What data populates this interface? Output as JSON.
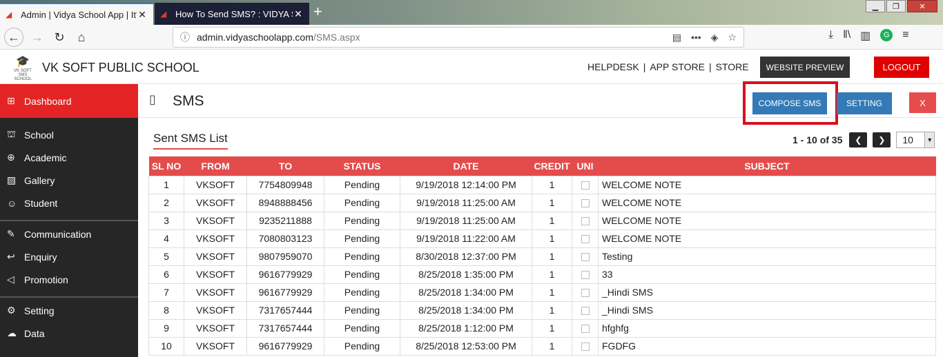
{
  "browser": {
    "tabs": [
      {
        "title": "Admin | Vidya School App | It's",
        "close": "✕"
      },
      {
        "title": "How To Send SMS? : VIDYA SCH",
        "close": "✕"
      }
    ],
    "url_host": "admin.vidyaschoolapp.com",
    "url_path": "/SMS.aspx"
  },
  "header": {
    "logo_text": "VK SOFT SMS SCHOOL",
    "school_name": "VK SOFT PUBLIC SCHOOL",
    "links": [
      "HELPDESK",
      "APP STORE",
      "STORE"
    ],
    "website_preview": "WEBSITE PREVIEW",
    "logout": "LOGOUT"
  },
  "sidebar": {
    "items": [
      {
        "label": "Dashboard",
        "icon": "dashboard-icon"
      },
      {
        "label": "School",
        "icon": "school-icon"
      },
      {
        "label": "Academic",
        "icon": "globe-icon"
      },
      {
        "label": "Gallery",
        "icon": "image-icon"
      },
      {
        "label": "Student",
        "icon": "student-icon"
      },
      {
        "label": "Communication",
        "icon": "megaphone-icon"
      },
      {
        "label": "Enquiry",
        "icon": "reply-icon"
      },
      {
        "label": "Promotion",
        "icon": "bullhorn-icon"
      },
      {
        "label": "Setting",
        "icon": "gear-icon"
      },
      {
        "label": "Data",
        "icon": "cloud-icon"
      }
    ]
  },
  "main": {
    "title": "SMS",
    "compose": "COMPOSE SMS",
    "setting": "SETTING",
    "close": "X",
    "list_title": "Sent SMS List",
    "pager_info": "1 - 10 of 35",
    "page_size": "10",
    "columns": [
      "SL NO",
      "FROM",
      "TO",
      "STATUS",
      "DATE",
      "CREDIT",
      "UNI",
      "SUBJECT"
    ],
    "rows": [
      [
        "1",
        "VKSOFT",
        "7754809948",
        "Pending",
        "9/19/2018 12:14:00 PM",
        "1",
        "",
        "WELCOME NOTE"
      ],
      [
        "2",
        "VKSOFT",
        "8948888456",
        "Pending",
        "9/19/2018 11:25:00 AM",
        "1",
        "",
        "WELCOME NOTE"
      ],
      [
        "3",
        "VKSOFT",
        "9235211888",
        "Pending",
        "9/19/2018 11:25:00 AM",
        "1",
        "",
        "WELCOME NOTE"
      ],
      [
        "4",
        "VKSOFT",
        "7080803123",
        "Pending",
        "9/19/2018 11:22:00 AM",
        "1",
        "",
        "WELCOME NOTE"
      ],
      [
        "5",
        "VKSOFT",
        "9807959070",
        "Pending",
        "8/30/2018 12:37:00 PM",
        "1",
        "",
        "Testing"
      ],
      [
        "6",
        "VKSOFT",
        "9616779929",
        "Pending",
        "8/25/2018 1:35:00 PM",
        "1",
        "",
        "33"
      ],
      [
        "7",
        "VKSOFT",
        "9616779929",
        "Pending",
        "8/25/2018 1:34:00 PM",
        "1",
        "",
        "_Hindi SMS"
      ],
      [
        "8",
        "VKSOFT",
        "7317657444",
        "Pending",
        "8/25/2018 1:34:00 PM",
        "1",
        "",
        "_Hindi SMS"
      ],
      [
        "9",
        "VKSOFT",
        "7317657444",
        "Pending",
        "8/25/2018 1:12:00 PM",
        "1",
        "",
        "hfghfg"
      ],
      [
        "10",
        "VKSOFT",
        "9616779929",
        "Pending",
        "8/25/2018 12:53:00 PM",
        "1",
        "",
        "FGDFG"
      ]
    ]
  }
}
